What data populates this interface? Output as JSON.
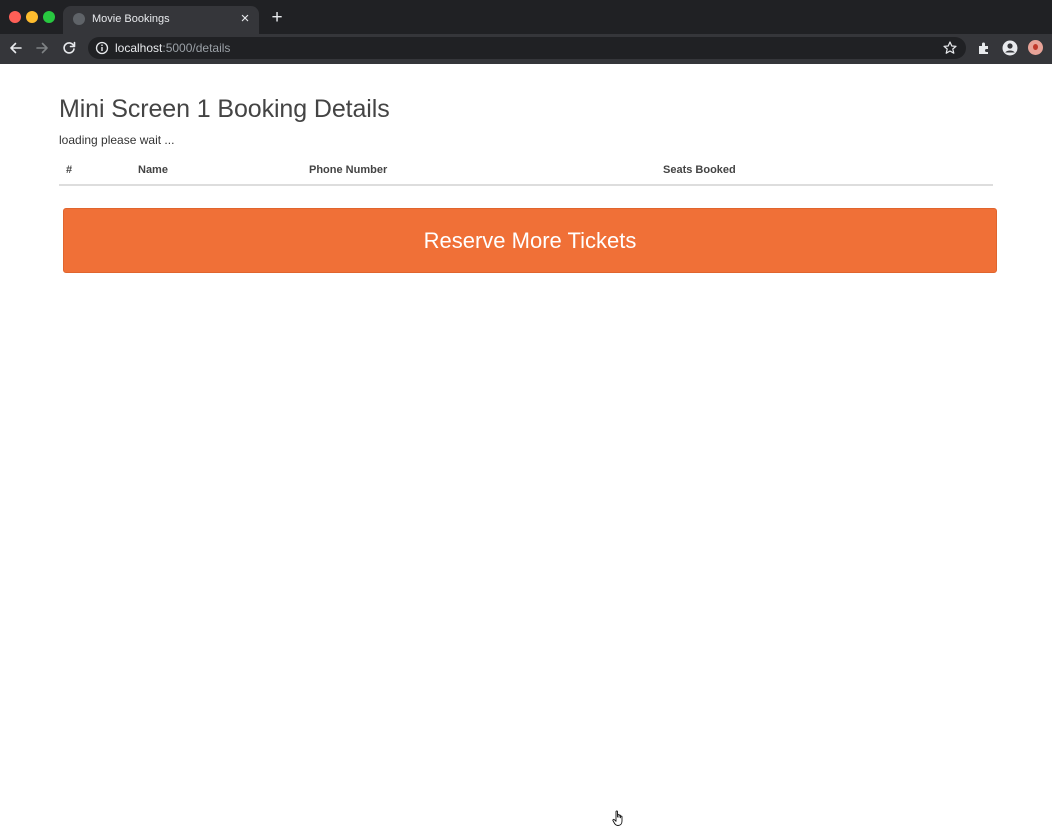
{
  "browser": {
    "tab_title": "Movie Bookings",
    "tab_close_glyph": "×",
    "new_tab_glyph": "+",
    "url_host": "localhost",
    "url_path": ":5000/details",
    "icons": [
      "back-arrow-icon",
      "forward-arrow-icon",
      "reload-icon",
      "info-icon",
      "star-icon",
      "extensions-icon",
      "profile-icon",
      "account-avatar-icon"
    ]
  },
  "main": {
    "title": "Mini Screen 1 Booking Details",
    "status": "loading please wait ...",
    "table": {
      "headers": [
        "#",
        "Name",
        "Phone Number",
        "Seats Booked"
      ],
      "rows": []
    },
    "reserve_label": "Reserve More Tickets"
  },
  "colors": {
    "accent": "#f07037",
    "title_text": "#444444",
    "chrome_dark": "#202124",
    "chrome_toolbar": "#35363a"
  }
}
